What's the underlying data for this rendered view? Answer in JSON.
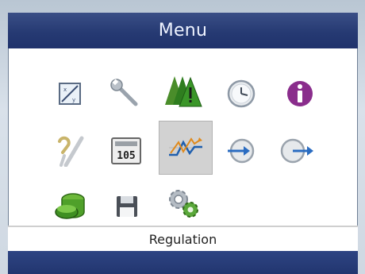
{
  "title": "Menu",
  "status": "Regulation",
  "colors": {
    "titlebar": "#263a73",
    "selected_bg": "#d2d2d2"
  },
  "icons": [
    {
      "row": 1,
      "name": "setpoint-icon",
      "interactable": true
    },
    {
      "row": 1,
      "name": "wrench-icon",
      "interactable": true
    },
    {
      "row": 1,
      "name": "alarm-warning-icon",
      "interactable": true
    },
    {
      "row": 1,
      "name": "clock-icon",
      "interactable": true
    },
    {
      "row": 1,
      "name": "info-icon",
      "interactable": true
    },
    {
      "row": 2,
      "name": "tools-check-icon",
      "interactable": true
    },
    {
      "row": 2,
      "name": "counter-display-icon",
      "interactable": true
    },
    {
      "row": 2,
      "name": "regulation-icon",
      "interactable": true,
      "selected": true
    },
    {
      "row": 2,
      "name": "login-icon",
      "interactable": true
    },
    {
      "row": 2,
      "name": "logout-icon",
      "interactable": true
    },
    {
      "row": 3,
      "name": "database-icon",
      "interactable": true
    },
    {
      "row": 3,
      "name": "save-icon",
      "interactable": true
    },
    {
      "row": 3,
      "name": "settings-gears-icon",
      "interactable": true
    }
  ],
  "counter_digits": "105"
}
